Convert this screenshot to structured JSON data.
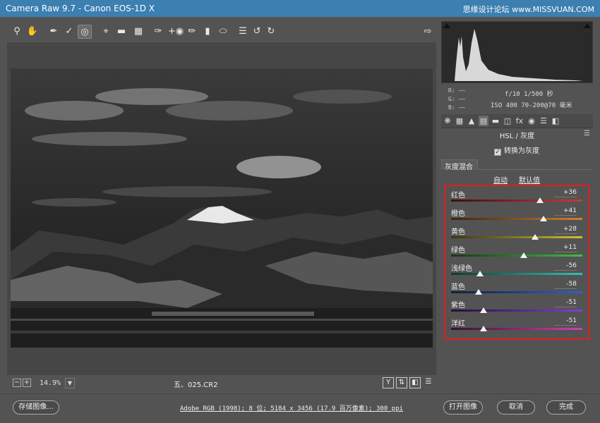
{
  "app": {
    "title": "Camera Raw 9.7 -  Canon EOS-1D X",
    "watermark": "思缘设计论坛 www.MISSVUAN.COM"
  },
  "toolbar": {
    "tools": [
      "zoom-icon",
      "hand-icon",
      "white-balance-icon",
      "color-sampler-icon",
      "targeted-adjustment-icon",
      "crop-icon",
      "straighten-icon",
      "transform-icon",
      "spot-removal-icon",
      "red-eye-icon",
      "adjustment-brush-icon",
      "graduated-filter-icon",
      "radial-filter-icon",
      "list-icon",
      "rotate-left-icon",
      "rotate-right-icon"
    ],
    "export_icon": "open-dialog-icon"
  },
  "status": {
    "zoom": "14.9%",
    "filename": "五、025.CR2",
    "icons": [
      "Y",
      "⇅",
      "◧",
      "☰"
    ]
  },
  "histogram": {
    "rgb_r": "R: ——",
    "rgb_g": "G: ——",
    "rgb_b": "B: ——",
    "aperture_shutter": "f/10   1/500 秒",
    "iso_lens": "ISO 400   70-200@70 毫米"
  },
  "panel": {
    "title": "HSL / 灰度",
    "convert_label": "转换为灰度",
    "convert_checked": true,
    "subtab": "灰度混合",
    "auto_link": "自动",
    "default_link": "默认值",
    "sliders": [
      {
        "name": "红色",
        "value": "+36",
        "position": 36,
        "from": "#3a1010",
        "to": "#c83a3a"
      },
      {
        "name": "橙色",
        "value": "+41",
        "position": 41,
        "from": "#3a2410",
        "to": "#d08030"
      },
      {
        "name": "黄色",
        "value": "+28",
        "position": 28,
        "from": "#3a3410",
        "to": "#d0c030"
      },
      {
        "name": "绿色",
        "value": "+11",
        "position": 11,
        "from": "#143a10",
        "to": "#40c040"
      },
      {
        "name": "浅绿色",
        "value": "-56",
        "position": -56,
        "from": "#103a30",
        "to": "#30c0b0"
      },
      {
        "name": "蓝色",
        "value": "-58",
        "position": -58,
        "from": "#10203a",
        "to": "#3060d0"
      },
      {
        "name": "紫色",
        "value": "-51",
        "position": -51,
        "from": "#24103a",
        "to": "#8040d0"
      },
      {
        "name": "洋红",
        "value": "-51",
        "position": -51,
        "from": "#3a1030",
        "to": "#d040b0"
      }
    ]
  },
  "bottom": {
    "save_label": "存储图像...",
    "workflow_link": "Adobe RGB (1998); 8 位; 5184 x 3456 (17.9 百万像素); 300 ppi",
    "open_label": "打开图像",
    "cancel_label": "取消",
    "done_label": "完成"
  }
}
